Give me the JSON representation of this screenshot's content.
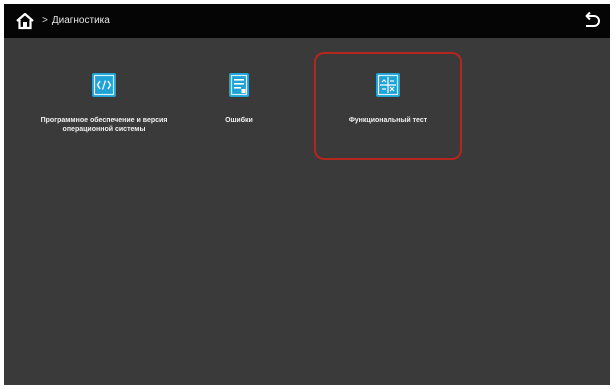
{
  "header": {
    "breadcrumb_separator": ">",
    "breadcrumb_label": "Диагностика"
  },
  "tiles": [
    {
      "label": "Программное обеспечение и версия операционной системы",
      "icon": "code-window-icon",
      "selected": false
    },
    {
      "label": "Ошибки",
      "icon": "document-list-icon",
      "selected": false
    },
    {
      "label": "Функциональный тест",
      "icon": "grid-test-icon",
      "selected": true
    }
  ],
  "colors": {
    "screen_bg": "#3a3a3a",
    "topbar_bg": "#050505",
    "icon_accent": "#1fa3d6",
    "selection_border": "#b3261e"
  }
}
